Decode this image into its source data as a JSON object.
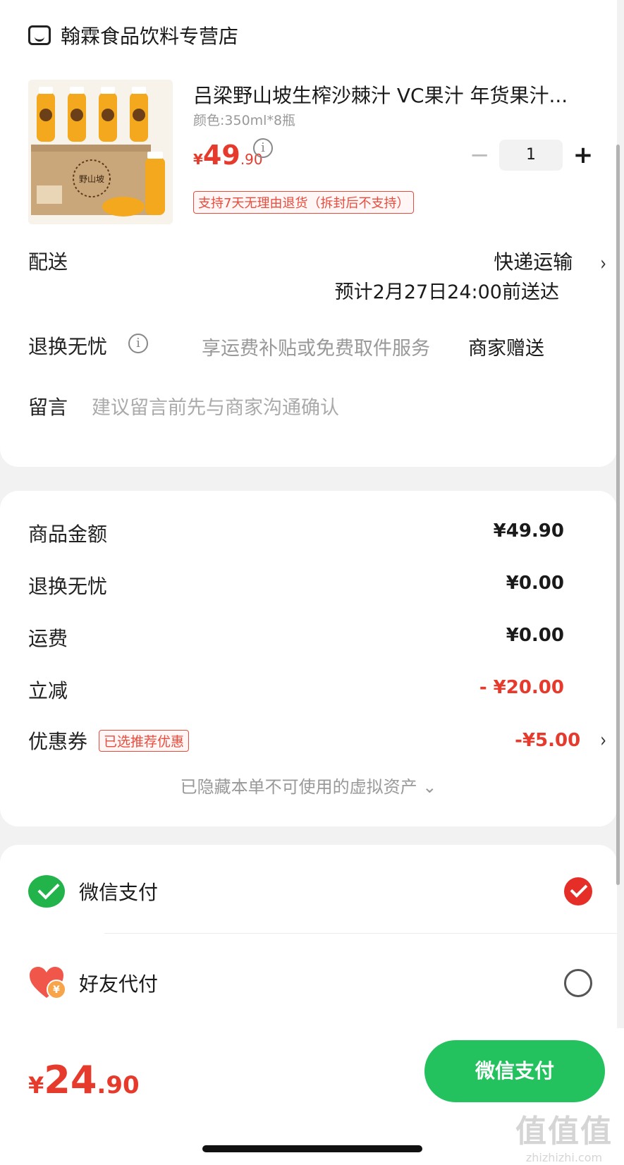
{
  "store": {
    "name": "翰霖食品饮料专营店",
    "icon": "store-icon"
  },
  "product": {
    "title": "吕梁野山坡生榨沙棘汁 VC果汁 年货果汁...",
    "variant": "颜色:350ml*8瓶",
    "price_symbol": "¥",
    "price_int": "49",
    "price_dec": ".90",
    "image_brand": "野山坡",
    "quantity": "1",
    "minus": "−",
    "plus": "+",
    "return_policy": "支持7天无理由退货（拆封后不支持）"
  },
  "delivery": {
    "label": "配送",
    "method": "快递运输",
    "eta": "预计2月27日24:00前送达"
  },
  "worry_free": {
    "label": "退换无忧",
    "info_glyph": "i",
    "desc": "享运费补贴或免费取件服务",
    "value": "商家赠送"
  },
  "message": {
    "label": "留言",
    "placeholder": "建议留言前先与商家沟通确认"
  },
  "summary": {
    "rows": [
      {
        "label": "商品金额",
        "value": "¥49.90"
      },
      {
        "label": "退换无忧",
        "value": "¥0.00"
      },
      {
        "label": "运费",
        "value": "¥0.00"
      },
      {
        "label": "立减",
        "value": "- ¥20.00"
      },
      {
        "label": "优惠券",
        "tag": "已选推荐优惠",
        "value": "-¥5.00"
      }
    ],
    "hidden_assets": "已隐藏本单不可使用的虚拟资产 ⌄"
  },
  "payment": {
    "options": [
      {
        "label": "微信支付",
        "icon": "wechat-pay-icon",
        "selected": true
      },
      {
        "label": "好友代付",
        "icon": "friend-pay-icon",
        "selected": false
      }
    ]
  },
  "footer": {
    "total_symbol": "¥",
    "total_int": "24",
    "total_dec": ".90",
    "pay_button": "微信支付"
  },
  "watermark": {
    "big": "值值值",
    "small": "zhizhizhi.com"
  },
  "colors": {
    "accent_red": "#e63a2c",
    "wechat_green": "#23c25f",
    "background": "#f2f2f2"
  }
}
